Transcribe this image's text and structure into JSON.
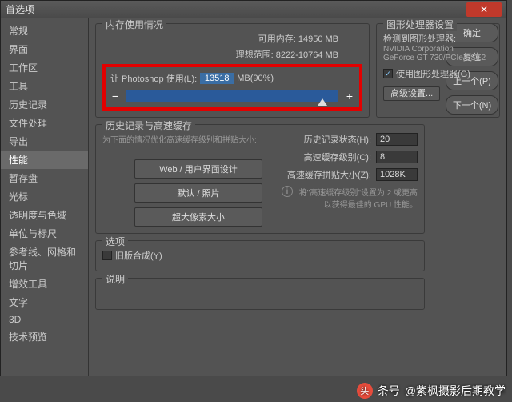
{
  "window": {
    "title": "首选项"
  },
  "sidebar": {
    "items": [
      {
        "label": "常规"
      },
      {
        "label": "界面"
      },
      {
        "label": "工作区"
      },
      {
        "label": "工具"
      },
      {
        "label": "历史记录"
      },
      {
        "label": "文件处理"
      },
      {
        "label": "导出"
      },
      {
        "label": "性能",
        "active": true
      },
      {
        "label": "暂存盘"
      },
      {
        "label": "光标"
      },
      {
        "label": "透明度与色域"
      },
      {
        "label": "单位与标尺"
      },
      {
        "label": "参考线、网格和切片"
      },
      {
        "label": "增效工具"
      },
      {
        "label": "文字"
      },
      {
        "label": "3D"
      },
      {
        "label": "技术预览"
      }
    ]
  },
  "buttons": {
    "ok": "确定",
    "reset": "复位",
    "prev": "上一个(P)",
    "next": "下一个(N)"
  },
  "memory": {
    "legend": "内存使用情况",
    "available_label": "可用内存:",
    "available_value": "14950 MB",
    "ideal_label": "理想范围:",
    "ideal_value": "8222-10764 MB",
    "let_label": "让 Photoshop 使用(L):",
    "let_value": "13518",
    "unit": "MB(90%)",
    "minus": "−",
    "plus": "+"
  },
  "gpu": {
    "legend": "图形处理器设置",
    "detected_label": "检测到图形处理器:",
    "vendor": "NVIDIA Corporation",
    "model": "GeForce GT 730/PCIe/SSE2",
    "use_checkbox": "使用图形处理器(G)",
    "advanced": "高级设置..."
  },
  "history": {
    "legend": "历史记录与高速缓存",
    "optimize_label": "为下面的情况优化高速缓存级别和拼贴大小:",
    "presets": [
      "Web / 用户界面设计",
      "默认 / 照片",
      "超大像素大小"
    ],
    "states_label": "历史记录状态(H):",
    "states_value": "20",
    "cache_label": "高速缓存级别(C):",
    "cache_value": "8",
    "tile_label": "高速缓存拼贴大小(Z):",
    "tile_value": "1028K",
    "hint": "将\"高速缓存级别\"设置为 2 或更高以获得最佳的 GPU 性能。"
  },
  "options": {
    "legend": "选项",
    "legacy": "旧版合成(Y)"
  },
  "description": {
    "legend": "说明"
  },
  "watermark": {
    "icon": "头",
    "suffix": "条号",
    "author": "@紫枫摄影后期教学"
  }
}
